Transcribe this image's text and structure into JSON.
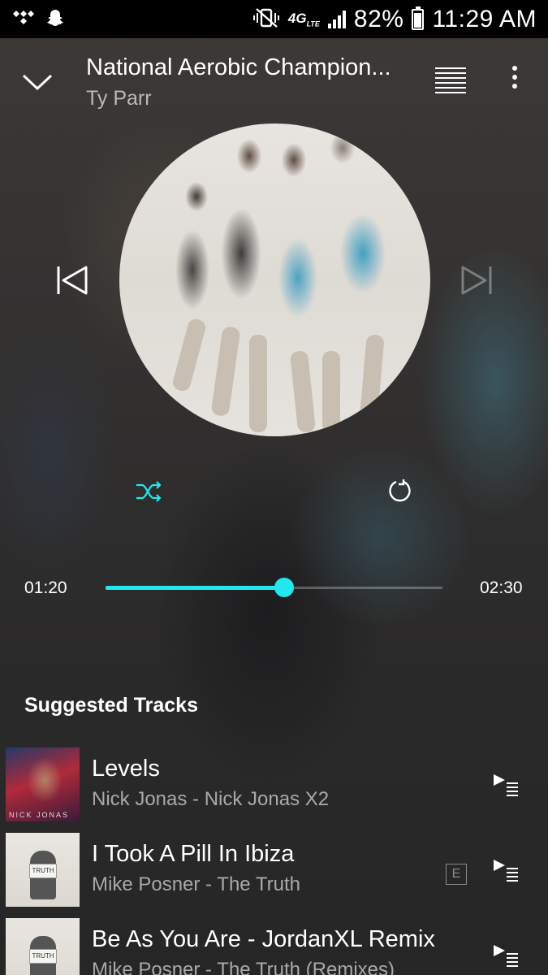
{
  "status_bar": {
    "battery": "82%",
    "time": "11:29 AM",
    "network": "4G",
    "network_sub": "LTE"
  },
  "player": {
    "title": "National Aerobic Champion...",
    "artist": "Ty Parr",
    "elapsed": "01:20",
    "total": "02:30",
    "progress": 0.53,
    "accent_color": "#20e8ee"
  },
  "suggested": {
    "heading": "Suggested Tracks",
    "tracks": [
      {
        "title": "Levels",
        "subtitle": "Nick Jonas - Nick Jonas X2",
        "explicit": false,
        "art_text": "NICK JONAS"
      },
      {
        "title": "I Took A Pill In Ibiza",
        "subtitle": "Mike Posner - The Truth",
        "explicit": true,
        "explicit_label": "E",
        "art_text": "TRUTH"
      },
      {
        "title": "Be As You Are - JordanXL Remix",
        "subtitle": "Mike Posner - The Truth (Remixes)",
        "explicit": false,
        "art_text": "TRUTH"
      }
    ]
  },
  "icons": {
    "collapse": "chevron-down-icon",
    "queue": "queue-list-icon",
    "more": "more-vertical-icon",
    "previous": "skip-previous-icon",
    "next": "skip-next-icon",
    "shuffle": "shuffle-icon",
    "repeat": "repeat-icon",
    "add_to_queue": "add-to-queue-icon"
  }
}
